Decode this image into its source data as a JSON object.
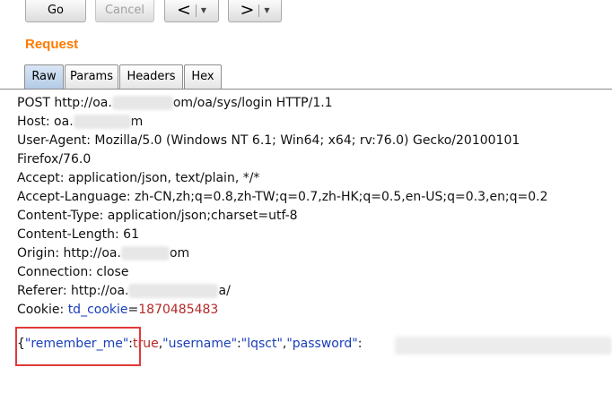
{
  "toolbar": {
    "go_label": "Go",
    "cancel_label": "Cancel",
    "back_glyph": "<",
    "forward_glyph": ">",
    "dropdown_glyph": "▼"
  },
  "section": {
    "title": "Request"
  },
  "tabs": [
    {
      "label": "Raw",
      "active": true
    },
    {
      "label": "Params",
      "active": false
    },
    {
      "label": "Headers",
      "active": false
    },
    {
      "label": "Hex",
      "active": false
    }
  ],
  "request": {
    "line1": {
      "prefix": "POST http://oa.",
      "suffix": "om/oa/sys/login HTTP/1.1"
    },
    "host": {
      "prefix": "Host: oa.",
      "suffix": "m"
    },
    "user_agent": "User-Agent: Mozilla/5.0 (Windows NT 6.1; Win64; x64; rv:76.0) Gecko/20100101",
    "user_agent_cont": "Firefox/76.0",
    "accept": "Accept: application/json, text/plain, */*",
    "accept_language": "Accept-Language: zh-CN,zh;q=0.8,zh-TW;q=0.7,zh-HK;q=0.5,en-US;q=0.3,en;q=0.2",
    "content_type": "Content-Type: application/json;charset=utf-8",
    "content_length": "Content-Length: 61",
    "origin": {
      "prefix": "Origin: http://oa.",
      "suffix": "om"
    },
    "connection": "Connection: close",
    "referer": {
      "prefix": "Referer: http://oa.",
      "suffix": "a/"
    },
    "cookie": {
      "label": "Cookie: ",
      "name": "td_cookie",
      "equals": "=",
      "value": "1870485483"
    },
    "body": {
      "open": "{",
      "key1": "\"remember_me\"",
      "colon1": ":",
      "val1": "true",
      "comma1": ",",
      "key2": "\"username\"",
      "colon2": ":",
      "val2": "\"lqsct\"",
      "comma2": ",",
      "key3": "\"password\"",
      "colon3": ":"
    }
  },
  "colors": {
    "section_title": "#ff7a00",
    "cookie_name": "#1a3fb8",
    "cookie_value": "#b42828",
    "highlight_border": "#e03a3a"
  }
}
